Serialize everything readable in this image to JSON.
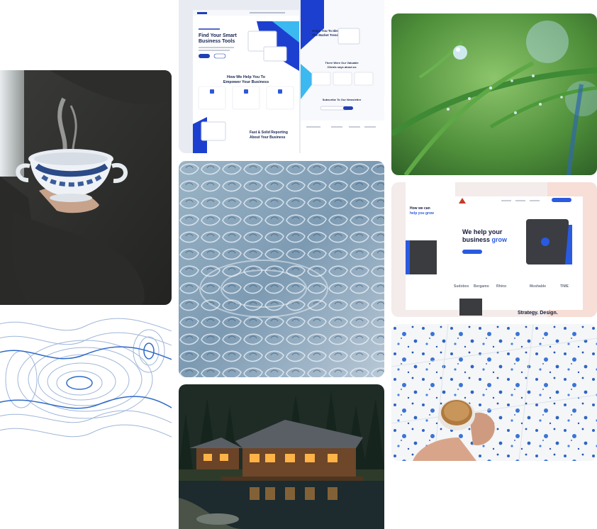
{
  "gallery": {
    "business_mockup": {
      "hero_title_line1": "Find Your Smart",
      "hero_title_line2": "Business Tools",
      "section_title_line1": "How We Help You To",
      "section_title_line2": "Empower Your Business",
      "reporting_line1": "Fast & Solid Reporting",
      "reporting_line2": "About Your Business",
      "side_title_line1": "Helps You To Identify",
      "side_title_line2": "The Market Trends",
      "clients_line1": "There Were Our Valuable",
      "clients_line2": "Clients says about us",
      "newsletter": "Subscribe To Our Newsletter"
    },
    "strategy_mockup": {
      "headline_line1": "We help your",
      "headline_line2_a": "business ",
      "headline_line2_b": "grow",
      "side_headline_line1": "How we can",
      "side_headline_line2": "help you grow",
      "tagline": "Strategy. Design.",
      "logos": [
        "Sudobox",
        "Bergamo",
        "Rhino",
        "Moshable",
        "TIME"
      ]
    }
  }
}
